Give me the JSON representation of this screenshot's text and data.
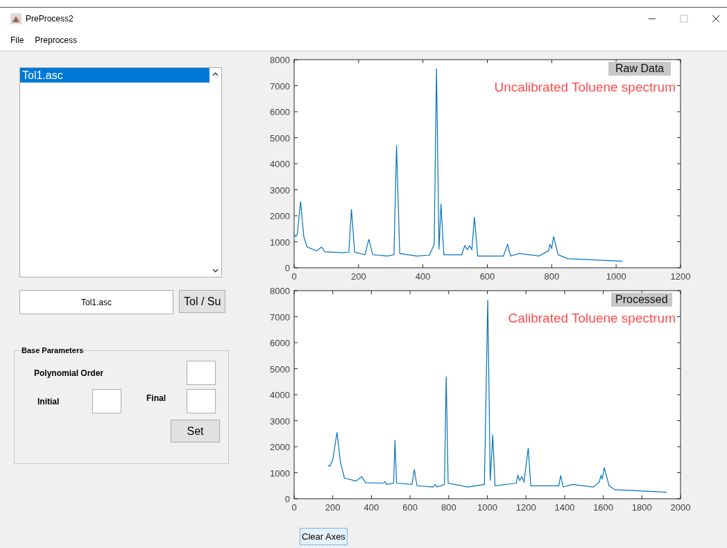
{
  "window": {
    "title": "PreProcess2"
  },
  "menu": [
    "File",
    "Preprocess"
  ],
  "file_list": {
    "items": [
      {
        "label": "Tol1.asc",
        "selected": true
      }
    ]
  },
  "file_field": {
    "value": "Tol1.asc"
  },
  "tol_button": "Tol / Su",
  "base_parameters": {
    "title": "Base Parameters",
    "polynomial_order_label": "Polynomial Order",
    "initial_label": "Initial",
    "final_label": "Final",
    "set_button": "Set"
  },
  "plots": [
    {
      "label": "Raw Data",
      "chart_data": {
        "type": "line",
        "annotations": [
          "Uncalibrated Toluene spectrum"
        ],
        "xlim": [
          0,
          1200
        ],
        "ylim": [
          0,
          8000
        ],
        "xticks": [
          0,
          200,
          400,
          600,
          800,
          1000,
          1200
        ],
        "yticks": [
          0,
          1000,
          2000,
          3000,
          4000,
          5000,
          6000,
          7000,
          8000
        ],
        "x": [
          0,
          5,
          10,
          20,
          30,
          40,
          70,
          85,
          95,
          150,
          170,
          178,
          188,
          220,
          232,
          244,
          290,
          310,
          318,
          328,
          380,
          420,
          435,
          442,
          450,
          456,
          465,
          520,
          530,
          538,
          545,
          552,
          560,
          570,
          650,
          663,
          672,
          700,
          760,
          790,
          795,
          800,
          806,
          820,
          850,
          1020
        ],
        "series": [
          {
            "color": "#0072bd",
            "values": [
              1300,
              1200,
              1300,
              2550,
              1200,
              800,
              650,
              800,
              620,
              580,
              600,
              2250,
              600,
              500,
              1100,
              500,
              450,
              500,
              4700,
              550,
              450,
              480,
              900,
              7650,
              700,
              2450,
              500,
              500,
              850,
              700,
              850,
              700,
              1950,
              450,
              450,
              900,
              450,
              550,
              450,
              650,
              900,
              750,
              1200,
              500,
              350,
              250
            ]
          }
        ]
      }
    },
    {
      "label": "Processed",
      "chart_data": {
        "type": "line",
        "annotations": [
          "Calibrated Toluene spectrum"
        ],
        "xlim": [
          0,
          2000
        ],
        "ylim": [
          0,
          8000
        ],
        "xticks": [
          0,
          200,
          400,
          600,
          800,
          1000,
          1200,
          1400,
          1600,
          1800,
          2000
        ],
        "yticks": [
          0,
          1000,
          2000,
          3000,
          4000,
          5000,
          6000,
          7000,
          8000
        ],
        "x": [
          175,
          185,
          200,
          222,
          240,
          260,
          320,
          350,
          370,
          460,
          470,
          480,
          515,
          522,
          530,
          610,
          622,
          636,
          720,
          730,
          740,
          778,
          787,
          797,
          900,
          985,
          1002,
          1015,
          1028,
          1040,
          1150,
          1158,
          1168,
          1178,
          1190,
          1212,
          1225,
          1370,
          1380,
          1392,
          1440,
          1550,
          1580,
          1588,
          1595,
          1605,
          1630,
          1660,
          1930
        ],
        "series": [
          {
            "color": "#0072bd",
            "values": [
              1300,
              1250,
              1500,
              2550,
              1400,
              800,
              680,
              850,
              620,
              600,
              650,
              550,
              600,
              2250,
              600,
              550,
              1130,
              500,
              450,
              550,
              450,
              550,
              4700,
              600,
              450,
              550,
              7650,
              700,
              2450,
              500,
              600,
              900,
              700,
              850,
              650,
              1950,
              500,
              500,
              900,
              450,
              550,
              450,
              650,
              900,
              750,
              1200,
              500,
              350,
              250
            ]
          }
        ]
      }
    }
  ],
  "clear_button": "Clear Axes"
}
